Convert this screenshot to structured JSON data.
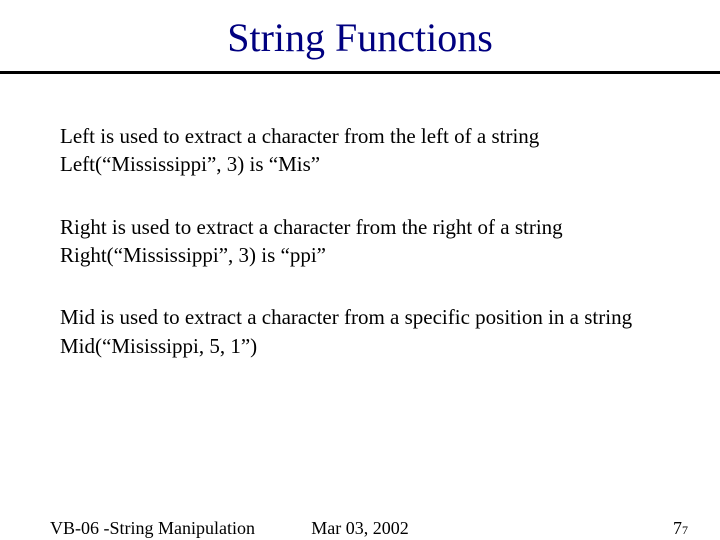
{
  "title": "String Functions",
  "blocks": [
    {
      "line1": "Left is used to extract a character from the left of a string",
      "line2": "Left(“Mississippi”, 3) is “Mis”"
    },
    {
      "line1": "Right is used to extract a character from the right of a string",
      "line2": "Right(“Mississippi”, 3) is “ppi”"
    },
    {
      "line1": "Mid is used to extract a character from a specific position in a string",
      "line2": "Mid(“Misissippi, 5, 1”)"
    }
  ],
  "footer": {
    "left": "VB-06 -String Manipulation",
    "center": "Mar 03, 2002",
    "right_main": "7",
    "right_sub": "7"
  }
}
